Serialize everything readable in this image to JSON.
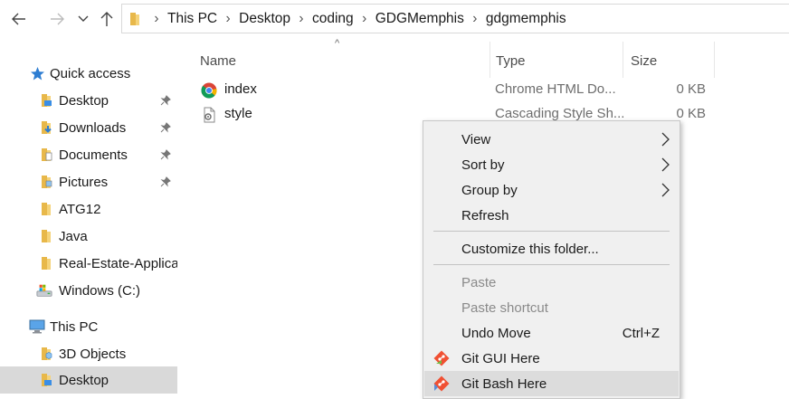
{
  "address_bar": {
    "breadcrumbs": [
      "This PC",
      "Desktop",
      "coding",
      "GDGMemphis",
      "gdgmemphis"
    ]
  },
  "sidebar": {
    "quick_access": "Quick access",
    "items": [
      {
        "label": "Desktop",
        "pinned": true
      },
      {
        "label": "Downloads",
        "pinned": true
      },
      {
        "label": "Documents",
        "pinned": true
      },
      {
        "label": "Pictures",
        "pinned": true
      },
      {
        "label": "ATG12",
        "pinned": false
      },
      {
        "label": "Java",
        "pinned": false
      },
      {
        "label": "Real-Estate-Applica",
        "pinned": false
      },
      {
        "label": "Windows (C:)",
        "pinned": false
      }
    ],
    "this_pc": "This PC",
    "this_pc_items": [
      {
        "label": "3D Objects"
      },
      {
        "label": "Desktop",
        "selected": true
      }
    ]
  },
  "columns": {
    "name": "Name",
    "type": "Type",
    "size": "Size"
  },
  "files": [
    {
      "name": "index",
      "type": "Chrome HTML Do...",
      "size": "0 KB",
      "icon": "chrome-icon"
    },
    {
      "name": "style",
      "type": "Cascading Style Sh...",
      "size": "0 KB",
      "icon": "css-file-icon"
    }
  ],
  "context_menu": {
    "view": "View",
    "sort_by": "Sort by",
    "group_by": "Group by",
    "refresh": "Refresh",
    "customize": "Customize this folder...",
    "paste": "Paste",
    "paste_shortcut": "Paste shortcut",
    "undo_move": "Undo Move",
    "undo_shortcut": "Ctrl+Z",
    "git_gui": "Git GUI Here",
    "git_bash": "Git Bash Here"
  },
  "colors": {
    "folder": "#e8b84a",
    "selection": "#d9d9d9",
    "menu_bg": "#f0f0f0",
    "menu_hover": "#dcdcdc",
    "git": "#f05033"
  }
}
